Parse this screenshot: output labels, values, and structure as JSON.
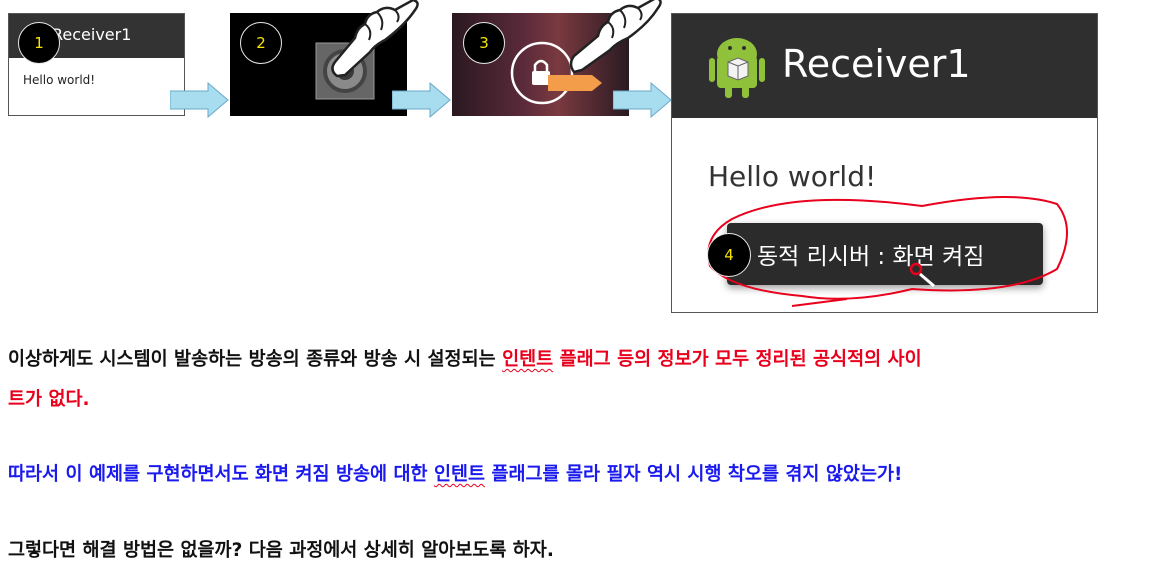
{
  "steps": [
    {
      "badge": "1",
      "app_title": "Receiver1",
      "hello": "Hello world!"
    },
    {
      "badge": "2"
    },
    {
      "badge": "3"
    },
    {
      "badge": "4",
      "app_title": "Receiver1",
      "hello": "Hello world!",
      "toast": "동적 리시버 : 화면 켜짐"
    }
  ],
  "paragraphs": {
    "p1_black": "이상하게도 시스템이 발송하는 방송의 종류와 방송 시 설정되는 ",
    "p1_red_a": "인텐트",
    "p1_red_b": " 플래그 등의 정보가 모두 정리된 공식적의 사이",
    "p1_red_c": "트가 없다.",
    "p2_a": "따라서 이 예제를 구현하면서도 화면 켜짐 방송에 대한 ",
    "p2_b": "인텐트",
    "p2_c": " 플래그를 몰라 필자 역시 시행 착오를 겪지 않았는가!",
    "p3": "그렇다면 해결 방법은 없을까? 다음 과정에서 상세히 알아보도록 하자."
  },
  "colors": {
    "badge_text": "#f5e400",
    "arrow_fill": "#a8dcef",
    "red_text": "#e8001c",
    "blue_text": "#1a1aee",
    "annotation": "#e8001c"
  },
  "icons": [
    "android-icon",
    "hand-pointer-icon",
    "lock-icon",
    "power-button-icon"
  ]
}
